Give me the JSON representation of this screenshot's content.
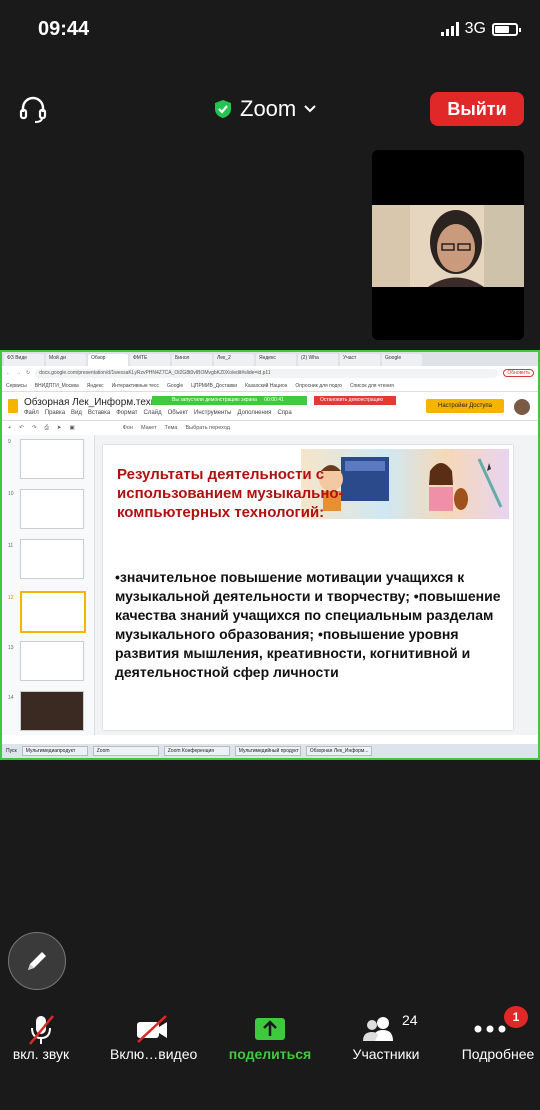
{
  "status": {
    "time": "09:44",
    "network": "3G"
  },
  "header": {
    "title": "Zoom",
    "leave_label": "Выйти"
  },
  "share": {
    "tabs": [
      "ФЗ Виде",
      "Мой ди",
      "Обзор",
      "ФМТЕ",
      "Бинол",
      "Лек_2",
      "Яндекс",
      "(2) Wha",
      "Участ",
      "Google"
    ],
    "url": "docs.google.com/presentation/d/1wexsaKLyRzvPHN4Z7CA_Ot2G8t0vIBOMvgbKZ0Xo/edit#slide=id.p11",
    "update_label": "Обновить",
    "bookmarks": [
      "Сервисы",
      "ВНИДПТИ_Москва",
      "Яндекс",
      "Интерактивные тесс",
      "Google",
      "ЦПРМИВ_Доставки",
      "Казахский Национ",
      "Опросник для подго",
      "Список для чтения"
    ],
    "doc_title": "Обзорная Лек_Информ.технологии",
    "menus": [
      "Файл",
      "Правка",
      "Вид",
      "Вставка",
      "Формат",
      "Слайд",
      "Объект",
      "Инструменты",
      "Дополнения",
      "Спра"
    ],
    "toolbar": [
      "Фон",
      "Макет",
      "Тема",
      "Выбрать переход"
    ],
    "banner": "Вы запустили демонстрацию экрана",
    "banner_time": "00:00:41",
    "stop_label": "Остановить демонстрацию",
    "access_label": "Настройки Доступа",
    "slide_numbers": [
      "9",
      "10",
      "11",
      "12",
      "13",
      "14"
    ],
    "slide": {
      "title": "Результаты деятельности с использованием музыкально-компьютерных технологий:",
      "bullets": "•значительное повышение мотивации учащихся к музыкальной деятельности и творчеству; •повышение качества знаний учащихся по специальным разделам музыкального образования; •повышение уровня развития мышления, креативности, когнитивной и деятельностной сфер личности"
    },
    "taskbar": [
      "Пуск",
      "Мультимедиапродукт",
      "Zoom",
      "Zoom Конференция",
      "Мультимедийный продукт",
      "Обзорная Лек_Информ..."
    ]
  },
  "controls": {
    "mute": "вкл. звук",
    "video": "Вклю…видео",
    "share": "поделиться",
    "participants": "Участники",
    "participants_count": "24",
    "more": "Подробнее",
    "more_badge": "1"
  },
  "colors": {
    "leave": "#e02828",
    "share_green": "#3ec93e",
    "slide_title": "#b01010"
  }
}
